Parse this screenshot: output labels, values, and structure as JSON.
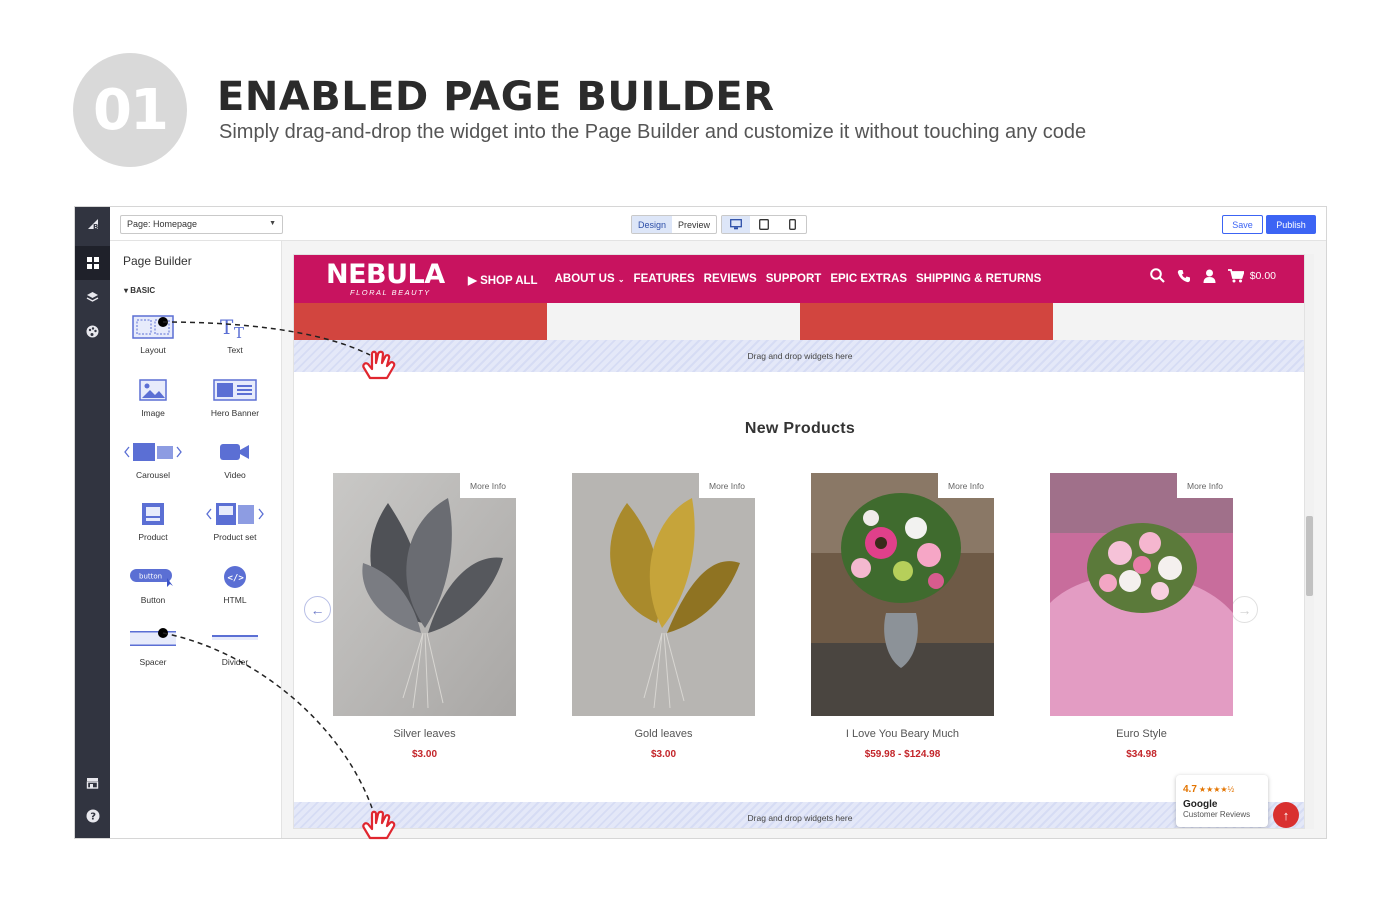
{
  "promo": {
    "badge_number": "01",
    "title": "ENABLED PAGE BUILDER",
    "subtitle": "Simply drag-and-drop the widget into the Page Builder and customize it without touching any code"
  },
  "topbar": {
    "page_select": "Page: Homepage",
    "mode_tabs": [
      "Design",
      "Preview"
    ],
    "active_mode": "Design",
    "device_icons": [
      "desktop-icon",
      "tablet-icon",
      "mobile-icon"
    ],
    "active_device": "desktop-icon",
    "save_label": "Save",
    "publish_label": "Publish"
  },
  "rail": {
    "icons": [
      "bigcommerce-logo-icon",
      "widgets-icon",
      "layers-icon",
      "palette-icon",
      "storefront-icon",
      "help-icon"
    ],
    "active": "widgets-icon"
  },
  "panel": {
    "title": "Page Builder",
    "section": "BASIC",
    "widgets": [
      {
        "label": "Layout",
        "icon": "layout-icon"
      },
      {
        "label": "Text",
        "icon": "text-icon"
      },
      {
        "label": "Image",
        "icon": "image-icon"
      },
      {
        "label": "Hero Banner",
        "icon": "hero-banner-icon"
      },
      {
        "label": "Carousel",
        "icon": "carousel-icon"
      },
      {
        "label": "Video",
        "icon": "video-icon"
      },
      {
        "label": "Product",
        "icon": "product-icon"
      },
      {
        "label": "Product set",
        "icon": "product-set-icon"
      },
      {
        "label": "Button",
        "icon": "button-icon",
        "icon_text": "button"
      },
      {
        "label": "HTML",
        "icon": "html-icon"
      },
      {
        "label": "Spacer",
        "icon": "spacer-icon"
      },
      {
        "label": "Divider",
        "icon": "divider-icon"
      }
    ]
  },
  "store": {
    "logo_main": "NEBULA",
    "logo_sub": "FLORAL BEAUTY",
    "nav": [
      "SHOP ALL",
      "ABOUT US",
      "FEATURES",
      "REVIEWS",
      "SUPPORT",
      "EPIC EXTRAS",
      "SHIPPING & RETURNS"
    ],
    "cart_total": "$0.00",
    "drop_zone_text": "Drag and drop widgets here",
    "section_title": "New Products",
    "more_info": "More Info",
    "products": [
      {
        "name": "Silver leaves",
        "price": "$3.00"
      },
      {
        "name": "Gold leaves",
        "price": "$3.00"
      },
      {
        "name": "I Love You Beary Much",
        "price": "$59.98 - $124.98"
      },
      {
        "name": "Euro Style",
        "price": "$34.98"
      }
    ],
    "review_badge": {
      "score": "4.7",
      "stars": 4.5,
      "brand": "Google",
      "caption": "Customer Reviews"
    }
  },
  "colors": {
    "brand": "#c8135f",
    "accent_blue": "#3c64f4",
    "price_red": "#c3252a",
    "drag_hand": "#e0262f"
  }
}
